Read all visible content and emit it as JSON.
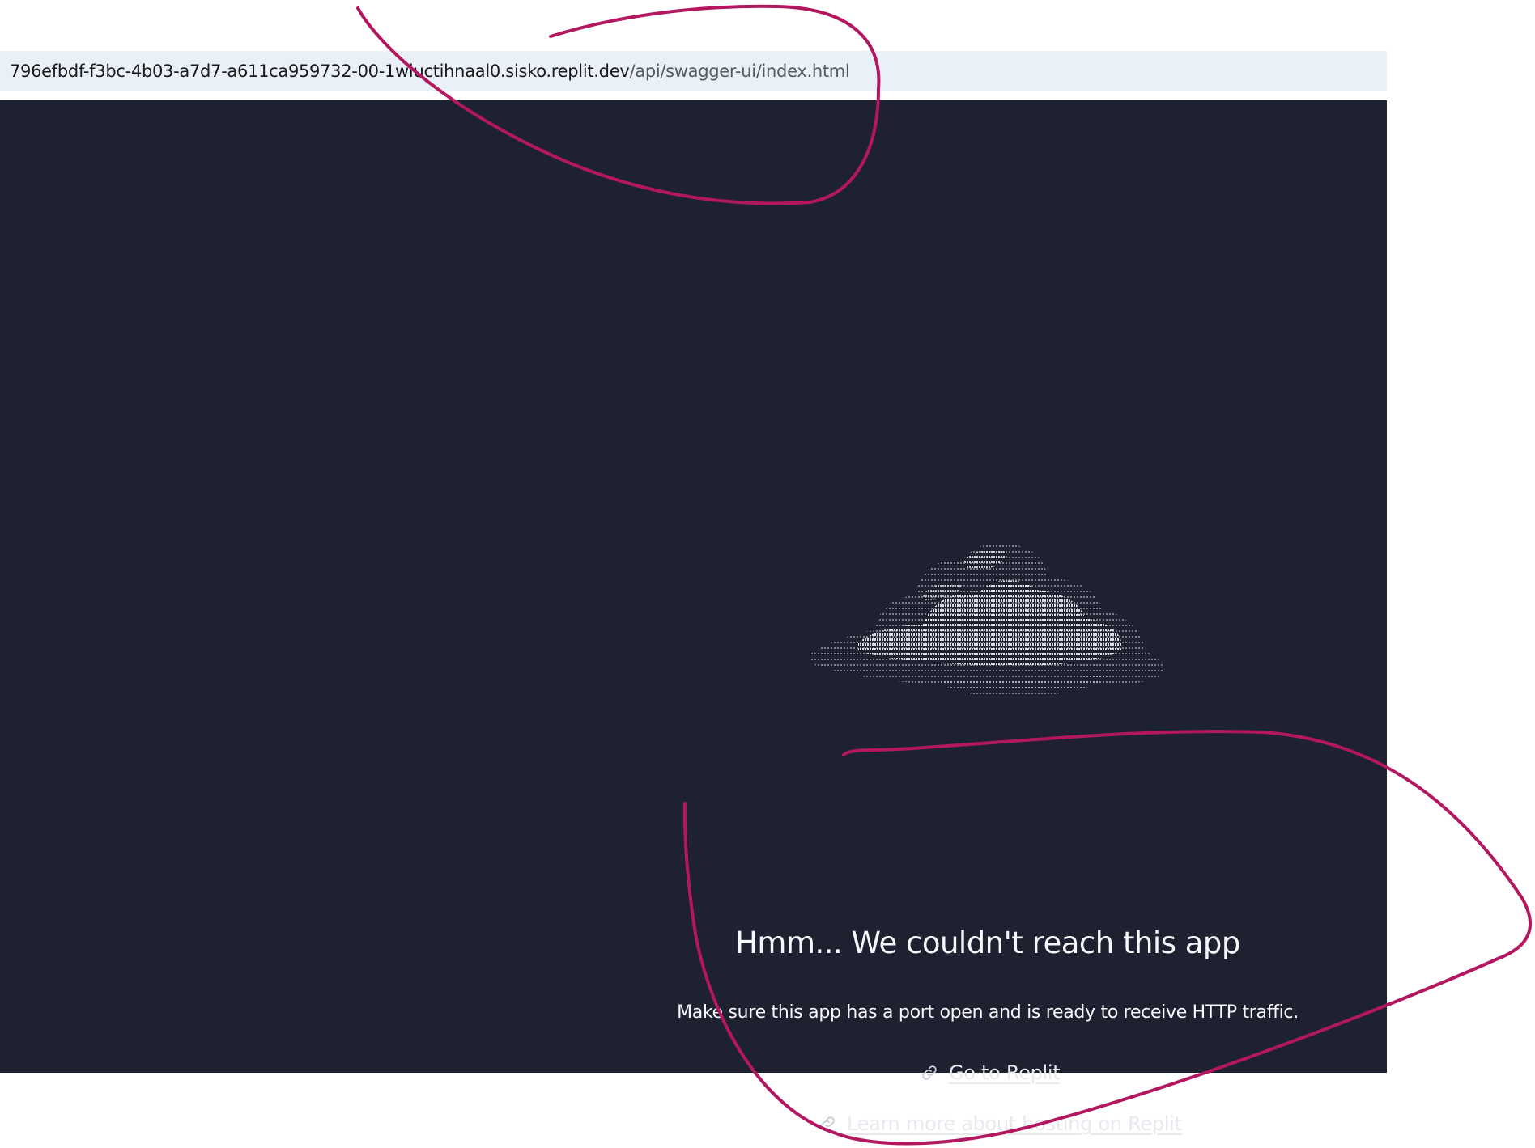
{
  "browser": {
    "url_host": "796efbdf-f3bc-4b03-a7d7-a611ca959732-00-1wiuctihnaal0.sisko.replit.dev",
    "url_path": "/api/swagger-ui/index.html"
  },
  "error_page": {
    "illustration_icon": "ascii-cloud-icon",
    "title": "Hmm... We couldn't reach this app",
    "message": "Make sure this app has a port open and is ready to receive HTTP traffic.",
    "links": [
      {
        "label": "Go to Replit",
        "icon": "link-icon"
      },
      {
        "label": "Learn more about hosting on Replit",
        "icon": "link-icon"
      }
    ]
  },
  "colors": {
    "page_background": "#1e2130",
    "url_bar_background": "#eaf0f8",
    "annotation_stroke": "#b3175f",
    "text": "#f5f7fb"
  }
}
